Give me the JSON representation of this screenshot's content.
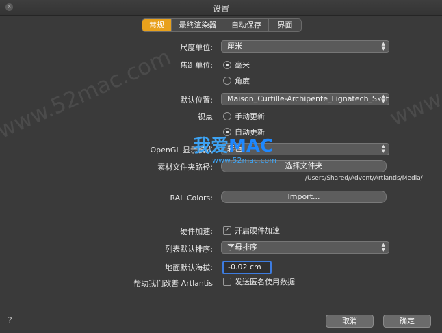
{
  "window": {
    "title": "设置",
    "close_glyph": "×"
  },
  "tabs": [
    {
      "label": "常规",
      "active": true
    },
    {
      "label": "最终渲染器",
      "active": false
    },
    {
      "label": "自动保存",
      "active": false
    },
    {
      "label": "界面",
      "active": false
    }
  ],
  "form": {
    "unit_label": "尺度单位:",
    "unit_value": "厘米",
    "focal_label": "焦距单位:",
    "focal_opt1": "毫米",
    "focal_opt2": "角度",
    "default_loc_label": "默认位置:",
    "default_loc_value": "Maison_Curtille-Archipente_Lignatech_Sket...",
    "view_label": "视点",
    "view_opt1": "手动更新",
    "view_opt2": "自动更新",
    "opengl_label": "OpenGL 显示模式",
    "opengl_value": "彩色",
    "material_label": "素材文件夹路径:",
    "material_button": "选择文件夹",
    "material_path": "/Users/Shared/Advent/Artlantis/Media/",
    "ral_label": "RAL Colors:",
    "ral_button": "Import...",
    "hw_label": "硬件加速:",
    "hw_check": "开启硬件加速",
    "sort_label": "列表默认排序:",
    "sort_value": "字母排序",
    "ground_label": "地面默认海拔:",
    "ground_value": "-0.02 cm",
    "help_label": "帮助我们改善 Artlantis",
    "help_check": "发送匿名使用数据"
  },
  "footer": {
    "help": "?",
    "cancel": "取消",
    "ok": "确定"
  },
  "watermark": {
    "text": "www.52mac.com",
    "logo_cn": "我爱",
    "logo_en": "MAC",
    "logo_url": "www.52mac.com"
  },
  "colors": {
    "accent_tab": "#e8a11c",
    "focus_ring": "#3d7ce0",
    "background": "#3a3a3a"
  }
}
